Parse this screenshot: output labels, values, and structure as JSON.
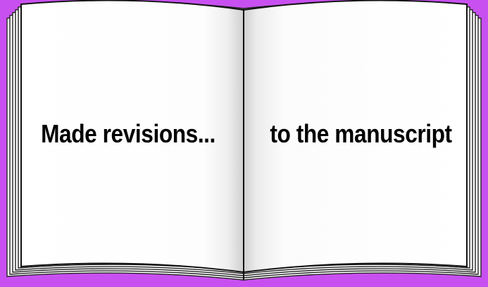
{
  "background_color": "#c850f0",
  "book": {
    "left_page": {
      "caption": "Made revisions..."
    },
    "right_page": {
      "caption": "to the manuscript"
    }
  }
}
